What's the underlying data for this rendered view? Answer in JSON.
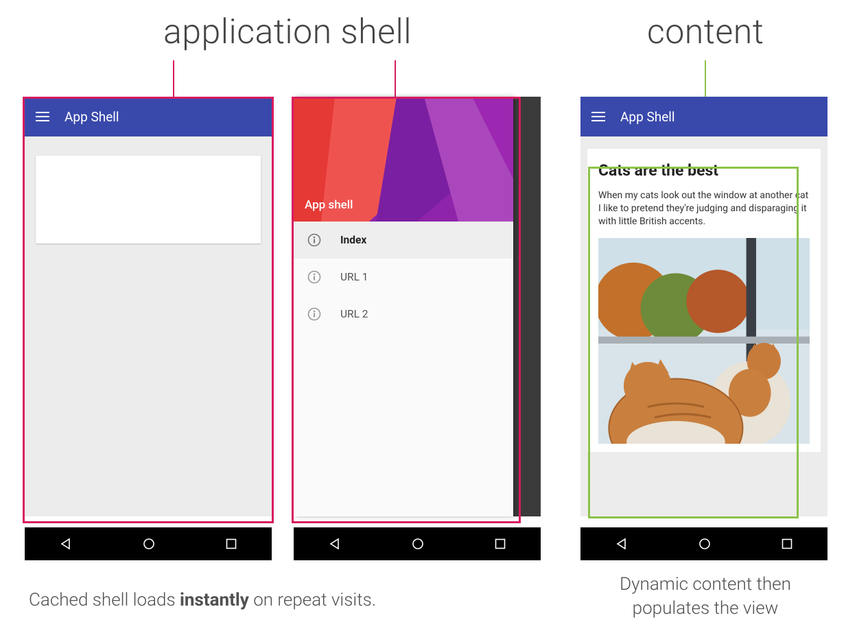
{
  "labels": {
    "app_shell": "application shell",
    "content": "content"
  },
  "colors": {
    "pink": "#d81b60",
    "green": "#8bc34a",
    "appbar": "#3949ab"
  },
  "phone1": {
    "appbar_title": "App Shell"
  },
  "phone2": {
    "drawer_header_title": "App shell",
    "items": [
      {
        "label": "Index",
        "selected": true
      },
      {
        "label": "URL 1",
        "selected": false
      },
      {
        "label": "URL 2",
        "selected": false
      }
    ]
  },
  "phone3": {
    "appbar_title": "App Shell",
    "article": {
      "title": "Cats are the best",
      "body": "When my cats look out the window at another cat I like to pretend they're judging and disparaging it with little British accents."
    }
  },
  "captions": {
    "left_pre": "Cached shell loads ",
    "left_bold": "instantly",
    "left_post": " on repeat visits.",
    "right": "Dynamic content then populates the view"
  }
}
